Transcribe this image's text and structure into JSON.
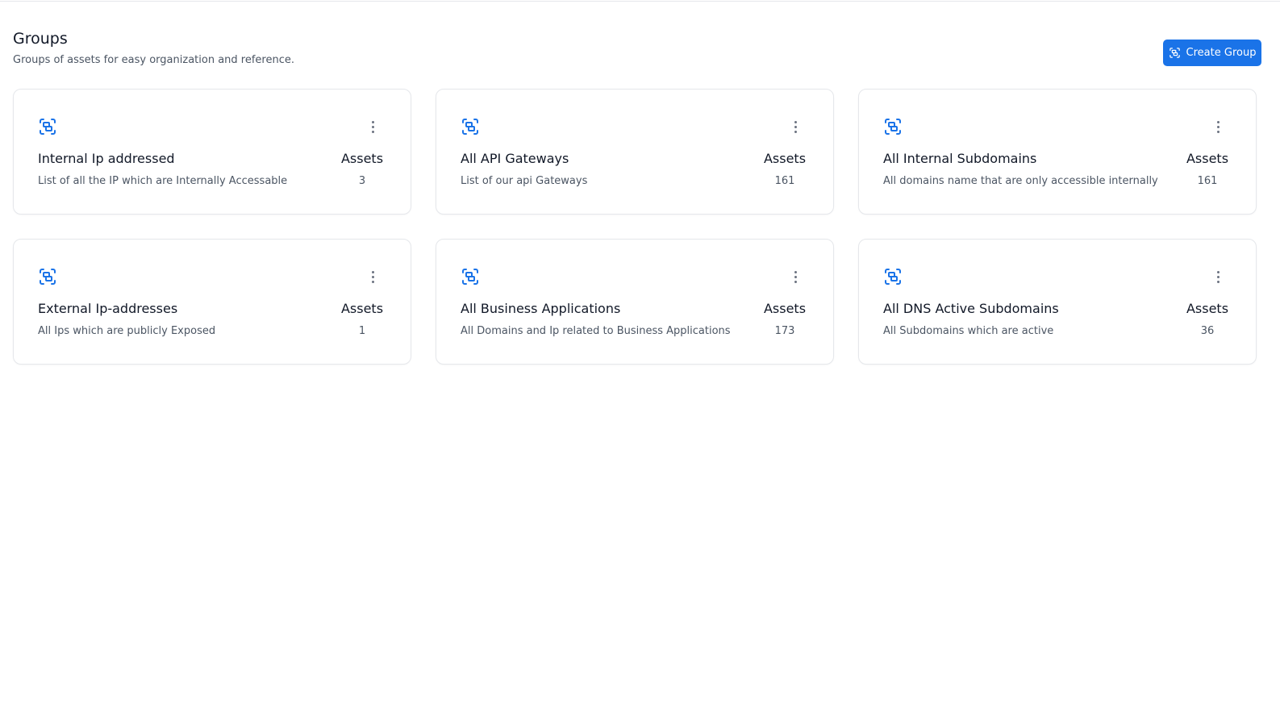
{
  "header": {
    "title": "Groups",
    "subtitle": "Groups of assets for easy organization and reference.",
    "create_button_label": "Create Group",
    "create_button_icon": "group-scan-icon"
  },
  "colors": {
    "accent": "#1a73e8",
    "text": "#111827",
    "muted": "#4b5563",
    "border": "#e5e7eb"
  },
  "assets_label": "Assets",
  "groups": [
    {
      "name": "Internal Ip addressed",
      "description": "List of all the IP which are Internally Accessable",
      "count": "3",
      "icon": "group-scan-icon"
    },
    {
      "name": "All API Gateways",
      "description": "List of our api Gateways",
      "count": "161",
      "icon": "group-scan-icon"
    },
    {
      "name": "All Internal Subdomains",
      "description": "All domains name that are only accessible internally",
      "count": "161",
      "icon": "group-scan-icon"
    },
    {
      "name": "External Ip-addresses",
      "description": "All Ips which are publicly Exposed",
      "count": "1",
      "icon": "group-scan-icon"
    },
    {
      "name": "All Business Applications",
      "description": "All Domains and Ip related to Business Applications",
      "count": "173",
      "icon": "group-scan-icon"
    },
    {
      "name": "All DNS Active Subdomains",
      "description": "All Subdomains which are active",
      "count": "36",
      "icon": "group-scan-icon"
    }
  ]
}
